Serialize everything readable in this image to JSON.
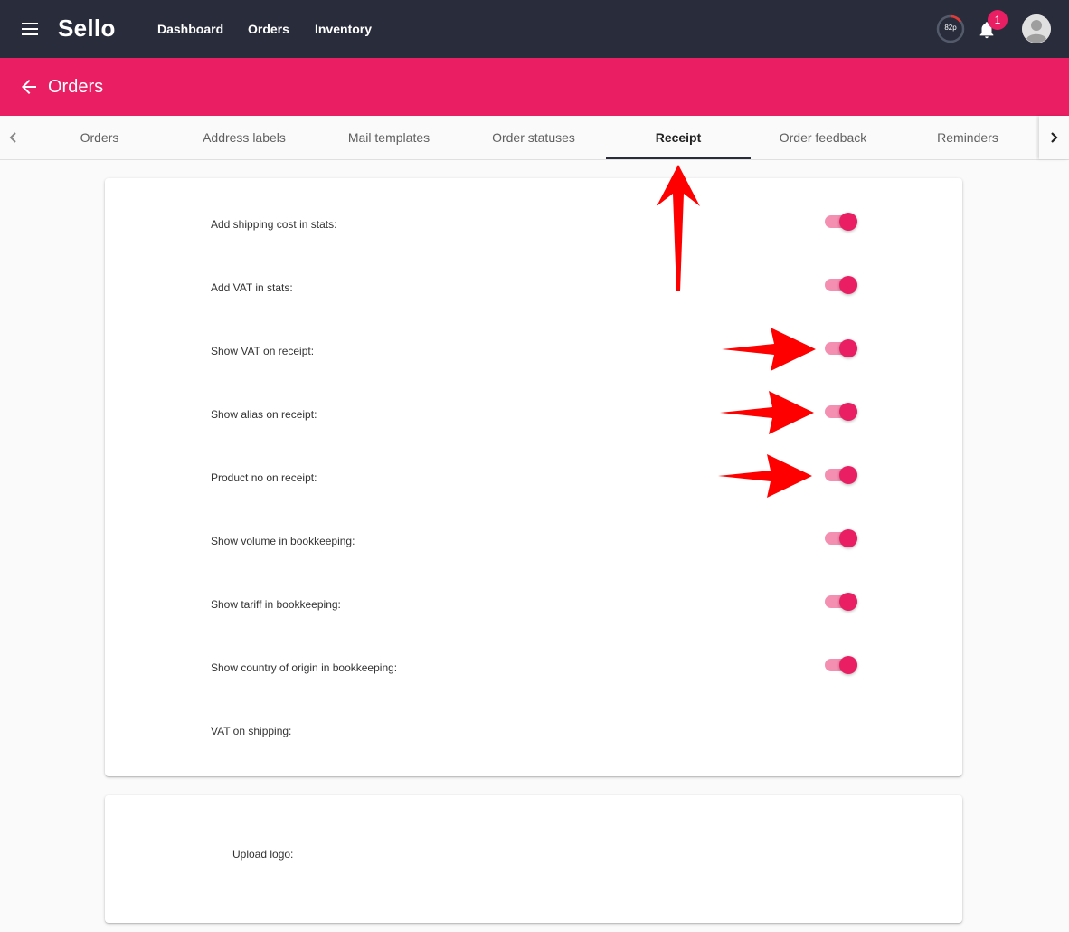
{
  "nav": {
    "brand": "Sello",
    "links": [
      "Dashboard",
      "Orders",
      "Inventory"
    ],
    "points": "82p",
    "notification_count": "1"
  },
  "page": {
    "title": "Orders"
  },
  "tabs": [
    "Orders",
    "Address labels",
    "Mail templates",
    "Order statuses",
    "Receipt",
    "Order feedback",
    "Reminders"
  ],
  "active_tab": "Receipt",
  "settings": [
    {
      "label": "Add shipping cost in stats:",
      "enabled": true
    },
    {
      "label": "Add VAT in stats:",
      "enabled": true
    },
    {
      "label": "Show VAT on receipt:",
      "enabled": true
    },
    {
      "label": "Show alias on receipt:",
      "enabled": true
    },
    {
      "label": "Product no on receipt:",
      "enabled": true
    },
    {
      "label": "Show volume in bookkeeping:",
      "enabled": true
    },
    {
      "label": "Show tariff in bookkeeping:",
      "enabled": true
    },
    {
      "label": "Show country of origin in bookkeeping:",
      "enabled": true
    },
    {
      "label": "VAT on shipping:"
    }
  ],
  "logo": {
    "label": "Upload logo:"
  },
  "colors": {
    "topbar": "#282c3b",
    "accent": "#e91e63",
    "toggle_track": "#f48fb1",
    "annotation": "#ff0000"
  }
}
